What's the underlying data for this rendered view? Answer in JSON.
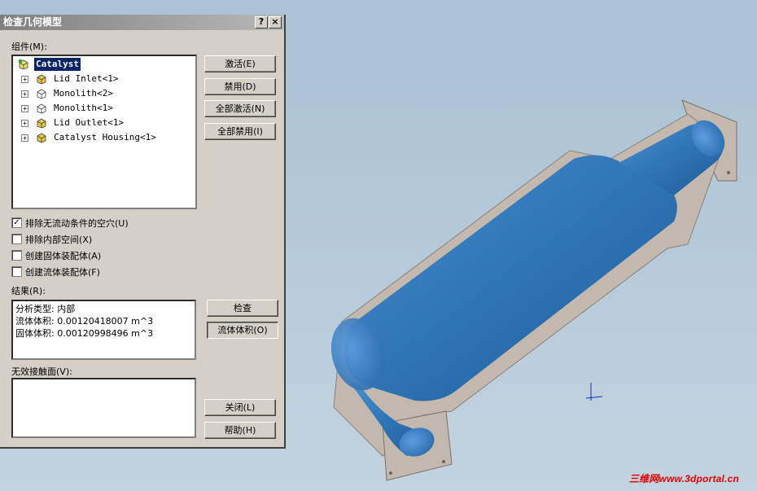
{
  "dialog": {
    "title": "检查几何模型",
    "help_button": "?",
    "close_button": "×",
    "components_label": "组件(M):",
    "tree": [
      {
        "label": "Catalyst",
        "selected": true,
        "icon": "assembly-icon"
      },
      {
        "label": "Lid Inlet<1>",
        "icon": "part-yellow-icon"
      },
      {
        "label": "Monolith<2>",
        "icon": "part-white-icon"
      },
      {
        "label": "Monolith<1>",
        "icon": "part-white-icon"
      },
      {
        "label": "Lid Outlet<1>",
        "icon": "part-yellow-icon"
      },
      {
        "label": "Catalyst Housing<1>",
        "icon": "part-yellow-icon"
      }
    ],
    "buttons": {
      "activate": "激活(E)",
      "disable": "禁用(D)",
      "activate_all": "全部激活(N)",
      "disable_all": "全部禁用(I)",
      "check": "检查",
      "fluid_volume": "流体体积(O)",
      "close": "关闭(L)",
      "help": "帮助(H)"
    },
    "options": [
      {
        "label": "排除无流动条件的空穴(U)",
        "checked": true
      },
      {
        "label": "排除内部空间(X)",
        "checked": false
      },
      {
        "label": "创建固体装配体(A)",
        "checked": false
      },
      {
        "label": "创建流体装配体(F)",
        "checked": false
      }
    ],
    "results_label": "结果(R):",
    "results": [
      "分析类型: 内部",
      "流体体积: 0.00120418007 m^3",
      "固体体积: 0.00120998496 m^3"
    ],
    "invalid_contacts_label": "无效接触面(V):"
  },
  "watermark": "三维网www.3dportal.cn",
  "colors": {
    "viewport_bg": "#b6cad9",
    "model_blue": "#2f74b5",
    "flange_gray": "#c2b8ae",
    "selection_bg": "#0a246a"
  }
}
